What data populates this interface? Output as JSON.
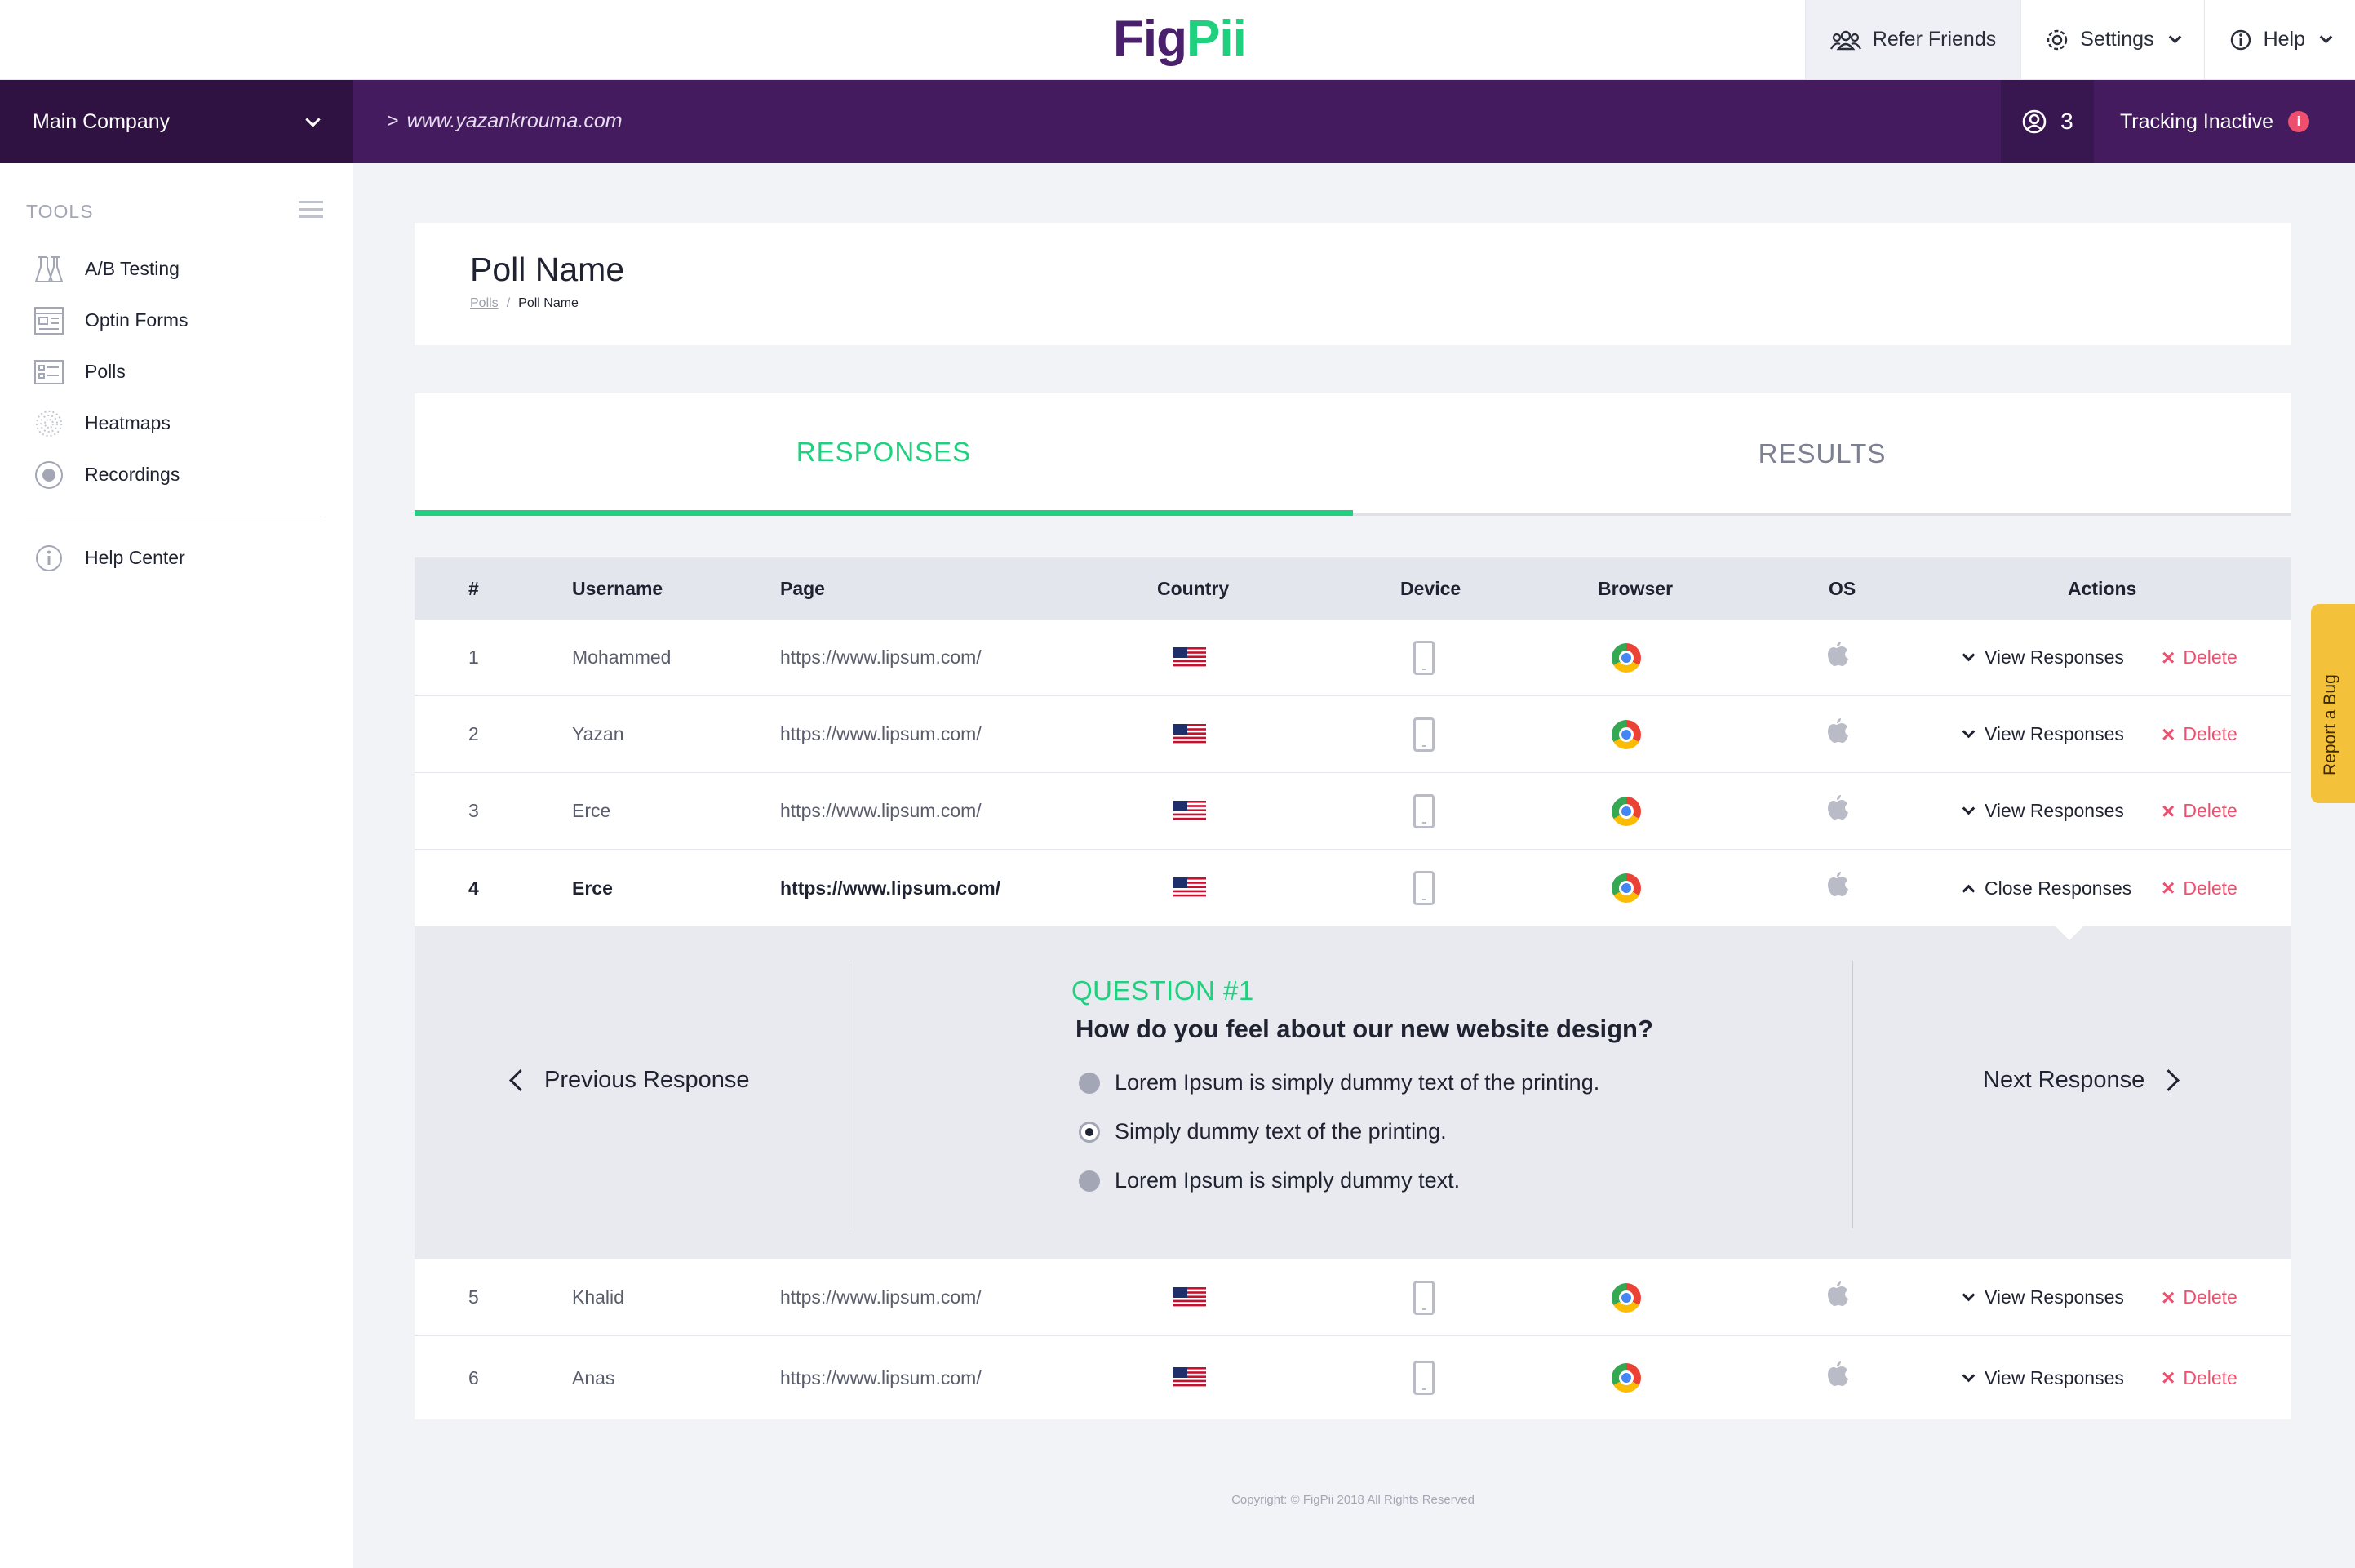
{
  "brand": {
    "part1": "Fig",
    "part2": "Pii"
  },
  "topnav": {
    "refer": "Refer Friends",
    "settings": "Settings",
    "help": "Help"
  },
  "bar": {
    "company": "Main Company",
    "site_prefix": ">",
    "site": "www.yazankrouma.com",
    "users_count": "3",
    "tracking": "Tracking Inactive"
  },
  "sidebar": {
    "tools_label": "TOOLS",
    "items": [
      {
        "label": "A/B Testing",
        "icon": "flask-icon"
      },
      {
        "label": "Optin Forms",
        "icon": "form-icon"
      },
      {
        "label": "Polls",
        "icon": "poll-icon"
      },
      {
        "label": "Heatmaps",
        "icon": "heatmap-icon"
      },
      {
        "label": "Recordings",
        "icon": "record-icon"
      }
    ],
    "help": "Help Center"
  },
  "header": {
    "title": "Poll Name",
    "crumb_link": "Polls",
    "crumb_sep": "/",
    "crumb_current": "Poll Name"
  },
  "tabs": {
    "responses": "RESPONSES",
    "results": "RESULTS"
  },
  "table": {
    "columns": [
      "#",
      "Username",
      "Page",
      "Country",
      "Device",
      "Browser",
      "OS",
      "Actions"
    ],
    "rows": [
      {
        "num": "1",
        "user": "Mohammed",
        "page": "https://www.lipsum.com/",
        "action": "View Responses",
        "delete": "Delete"
      },
      {
        "num": "2",
        "user": "Yazan",
        "page": "https://www.lipsum.com/",
        "action": "View Responses",
        "delete": "Delete"
      },
      {
        "num": "3",
        "user": "Erce",
        "page": "https://www.lipsum.com/",
        "action": "View Responses",
        "delete": "Delete"
      },
      {
        "num": "4",
        "user": "Erce",
        "page": "https://www.lipsum.com/",
        "action": "Close Responses",
        "delete": "Delete"
      },
      {
        "num": "5",
        "user": "Khalid",
        "page": "https://www.lipsum.com/",
        "action": "View Responses",
        "delete": "Delete"
      },
      {
        "num": "6",
        "user": "Anas",
        "page": "https://www.lipsum.com/",
        "action": "View Responses",
        "delete": "Delete"
      }
    ]
  },
  "expanded": {
    "prev": "Previous Response",
    "next": "Next Response",
    "question_label": "QUESTION #1",
    "question": "How do you feel about our new website design?",
    "options": [
      {
        "text": "Lorem Ipsum is simply dummy text of the printing.",
        "selected": false
      },
      {
        "text": "Simply dummy text of the printing.",
        "selected": true
      },
      {
        "text": "Lorem Ipsum is simply dummy text.",
        "selected": false
      }
    ]
  },
  "footer": "Copyright: © FigPii 2018 All Rights Reserved",
  "report_bug": "Report a Bug",
  "colors": {
    "accent": "#1fd07f",
    "brand_purple": "#431b5e",
    "delete": "#ef4f6e",
    "bug": "#f3c13a"
  }
}
